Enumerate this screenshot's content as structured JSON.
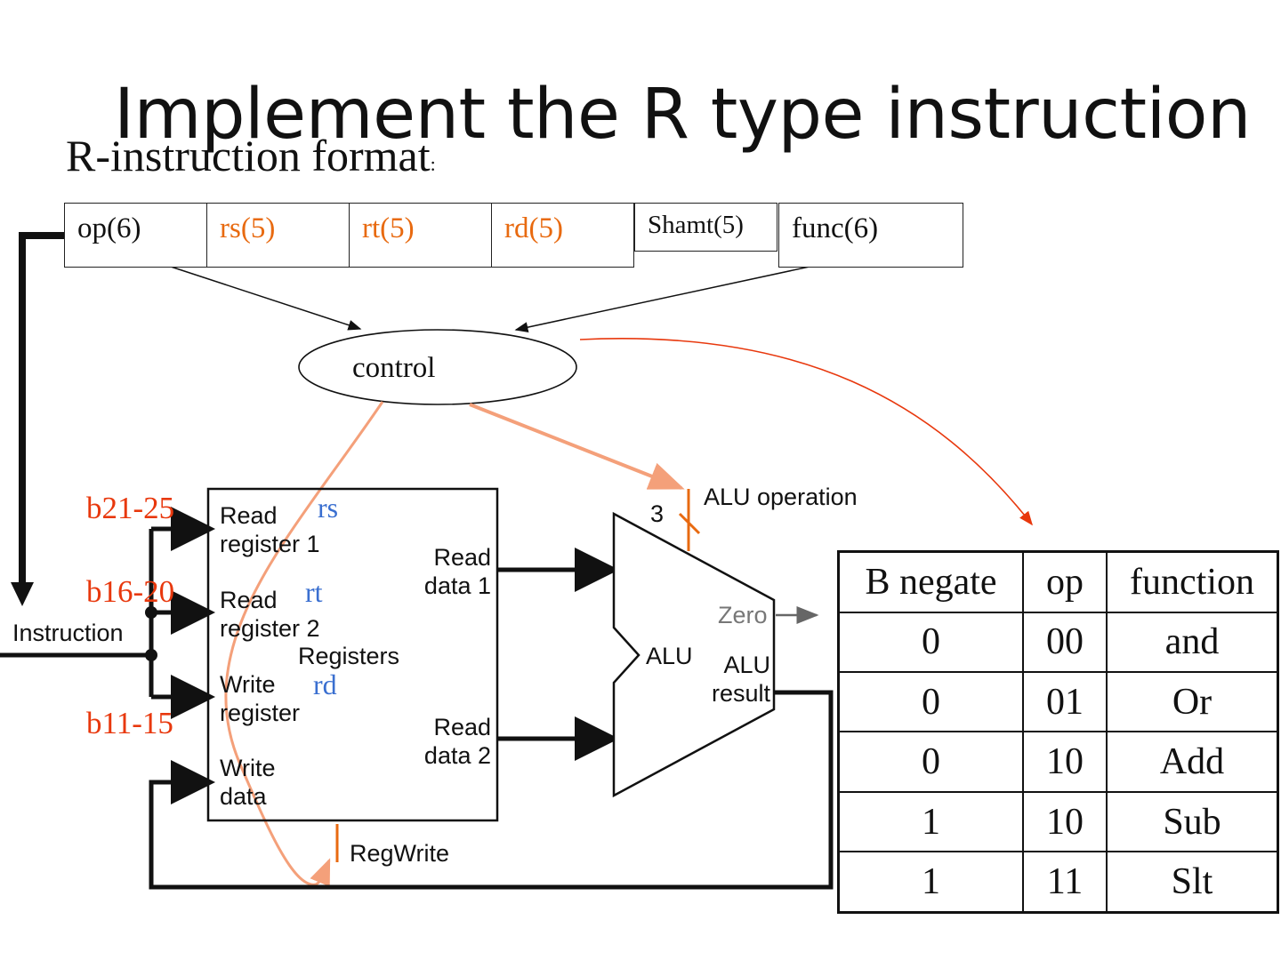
{
  "title": "Implement the R type instruction",
  "subtitle": "R-instruction format",
  "subtitle_colon": ":",
  "format_fields": [
    {
      "label": "op(6)",
      "color": "#111111"
    },
    {
      "label": "rs(5)",
      "color": "#e86a10"
    },
    {
      "label": "rt(5)",
      "color": "#e86a10"
    },
    {
      "label": "rd(5)",
      "color": "#e86a10"
    },
    {
      "label": "Shamt(5)",
      "color": "#111111"
    },
    {
      "label": "func(6)",
      "color": "#111111"
    }
  ],
  "control_label": "control",
  "bit_ranges": [
    "b21-25",
    "b16-20",
    "b11-15"
  ],
  "instruction_label": "Instruction",
  "registers": {
    "read_register_1": "Read register 1",
    "read_register_2": "Read register 2",
    "write_register": "Write register",
    "write_data": "Write data",
    "read_data_1": "Read data 1",
    "read_data_2": "Read data 2",
    "title": "Registers",
    "rs": "rs",
    "rt": "rt",
    "rd": "rd"
  },
  "alu": {
    "label": "ALU",
    "zero": "Zero",
    "result": "ALU result",
    "operation_label": "ALU operation",
    "operation_bits": "3"
  },
  "regwrite_label": "RegWrite",
  "function_table": {
    "headers": [
      "B negate",
      "op",
      "function"
    ],
    "rows": [
      [
        "0",
        "00",
        "and"
      ],
      [
        "0",
        "01",
        "Or"
      ],
      [
        "0",
        "10",
        "Add"
      ],
      [
        "1",
        "10",
        "Sub"
      ],
      [
        "1",
        "11",
        "Slt"
      ]
    ]
  },
  "colors": {
    "accent_orange": "#e86a10",
    "bit_red": "#e8380d",
    "register_blue": "#3a6fd0",
    "control_line": "#f4a07a"
  }
}
